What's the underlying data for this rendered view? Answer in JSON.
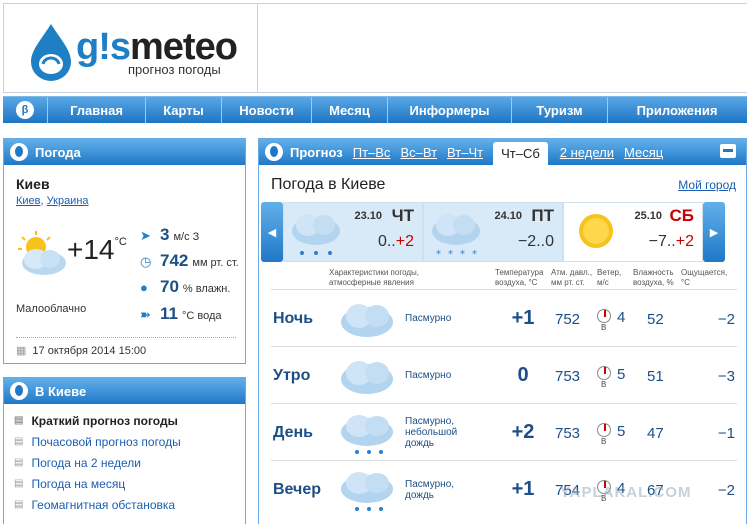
{
  "header": {
    "logo_a": "g!s",
    "logo_b": "meteo",
    "subtitle": "прогноз погоды"
  },
  "nav": {
    "brand": "β",
    "items": [
      "Главная",
      "Карты",
      "Новости",
      "Месяц",
      "Информеры",
      "Туризм",
      "Приложения"
    ]
  },
  "weather_panel": {
    "title": "Погода",
    "city": "Киев",
    "city_link": "Киев",
    "country_link": "Украина",
    "temp": "+14",
    "temp_unit": "°C",
    "wind_value": "3",
    "wind_unit": "м/с  З",
    "pressure_value": "742",
    "pressure_unit": "мм рт. ст.",
    "humidity_value": "70",
    "humidity_unit": "% влажн.",
    "water_value": "11",
    "water_unit": "°C вода",
    "description": "Малооблачно",
    "datetime": "17 октября 2014 15:00"
  },
  "kiev_panel": {
    "title": "В Киеве",
    "links": [
      "Краткий прогноз погоды",
      "Почасовой прогноз погоды",
      "Погода на 2 недели",
      "Погода на месяц",
      "Геомагнитная обстановка"
    ]
  },
  "forecast": {
    "tab_label": "Прогноз",
    "tabs": [
      "Пт–Вс",
      "Вс–Вт",
      "Вт–Чт",
      "Чт–Сб",
      "2 недели",
      "Месяц"
    ],
    "active_tab": "Чт–Сб",
    "title": "Погода в Киеве",
    "my_city": "Мой город",
    "days": [
      {
        "date": "23.10",
        "name": "ЧТ",
        "t_min": "0..",
        "t_max": "+2",
        "icon": "cloud-rain-icon"
      },
      {
        "date": "24.10",
        "name": "ПТ",
        "t_min": "−2..",
        "t_max": "0",
        "icon": "cloud-snow-icon"
      },
      {
        "date": "25.10",
        "name": "СБ",
        "t_min": "−7..",
        "t_max": "+2",
        "icon": "sun-icon"
      }
    ],
    "columns": {
      "desc": "Характеристики погоды, атмосферные явления",
      "temp": "Температура воздуха, °C",
      "pres": "Атм. давл., мм рт. ст.",
      "wind": "Ветер, м/с",
      "hum": "Влажность воздуха, %",
      "feel": "Ощущается, °C"
    },
    "rows": [
      {
        "name": "Ночь",
        "desc": "Пасмурно",
        "temp": "+1",
        "pres": "752",
        "wind_dir": "В",
        "wind": "4",
        "hum": "52",
        "feel": "−2"
      },
      {
        "name": "Утро",
        "desc": "Пасмурно",
        "temp": "0",
        "pres": "753",
        "wind_dir": "В",
        "wind": "5",
        "hum": "51",
        "feel": "−3"
      },
      {
        "name": "День",
        "desc": "Пасмурно, небольшой дождь",
        "temp": "+2",
        "pres": "753",
        "wind_dir": "В",
        "wind": "5",
        "hum": "47",
        "feel": "−1"
      },
      {
        "name": "Вечер",
        "desc": "Пасмурно, дождь",
        "temp": "+1",
        "pres": "754",
        "wind_dir": "В",
        "wind": "4",
        "hum": "67",
        "feel": "−2"
      }
    ]
  },
  "watermark": "YAPLAKAL.COM",
  "colors": {
    "accent": "#1f78c7",
    "link": "#1a5fb4",
    "value": "#1d4f86",
    "red": "#cc0000"
  }
}
